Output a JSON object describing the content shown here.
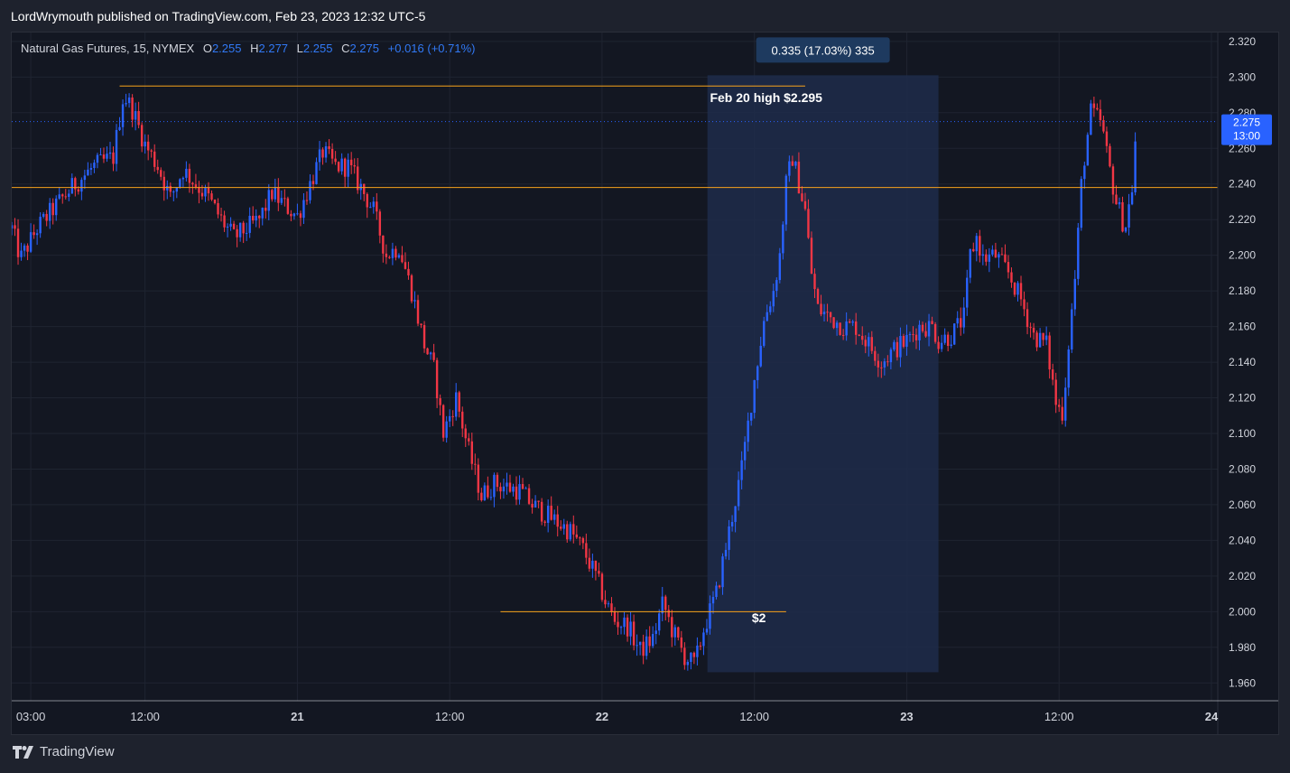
{
  "header": {
    "published_text": "LordWrymouth published on TradingView.com, Feb 23, 2023 12:32 UTC-5"
  },
  "legend": {
    "title": "Natural Gas Futures, 15, NYMEX",
    "open_label": "O",
    "open_value": "2.255",
    "high_label": "H",
    "high_value": "2.277",
    "low_label": "L",
    "low_value": "2.255",
    "close_label": "C",
    "close_value": "2.275",
    "change": "+0.016 (+0.71%)"
  },
  "footer": {
    "brand": "TradingView"
  },
  "colors": {
    "background": "#131722",
    "up": "#2962ff",
    "down": "#f23645",
    "hline": "#f7a21b",
    "range_fill": "#1e2b4a",
    "price_tag": "#2962ff"
  },
  "chart_data": {
    "type": "candlestick",
    "symbol": "Natural Gas Futures",
    "interval": "15",
    "exchange": "NYMEX",
    "y_axis": {
      "ylim": [
        1.95,
        2.325
      ],
      "ticks": [
        "2.320",
        "2.300",
        "2.280",
        "2.260",
        "2.240",
        "2.220",
        "2.200",
        "2.180",
        "2.160",
        "2.140",
        "2.120",
        "2.100",
        "2.080",
        "2.060",
        "2.040",
        "2.020",
        "2.000",
        "1.980",
        "1.960"
      ]
    },
    "x_axis": {
      "ticks": [
        {
          "label": "03:00",
          "t": 3
        },
        {
          "label": "12:00",
          "t": 12
        },
        {
          "label": "21",
          "t": 24
        },
        {
          "label": "12:00",
          "t": 36
        },
        {
          "label": "22",
          "t": 48
        },
        {
          "label": "12:00",
          "t": 60
        },
        {
          "label": "23",
          "t": 72
        },
        {
          "label": "12:00",
          "t": 84
        },
        {
          "label": "24",
          "t": 96
        }
      ],
      "xlim": [
        1.5,
        96.5
      ],
      "unit": "hours since Feb 20 00:00"
    },
    "current_price": {
      "value": 2.275,
      "label": "2.275",
      "countdown": "13:00"
    },
    "horizontal_lines": [
      {
        "value": 2.295,
        "t_start": 10,
        "t_end": 64
      },
      {
        "value": 2.238,
        "t_start": 1.5,
        "t_end": 96.5
      },
      {
        "value": 2.0,
        "t_start": 40,
        "t_end": 62.5
      }
    ],
    "annotations": [
      {
        "text": "Feb 20 high $2.295",
        "t": 56.5,
        "value": 2.286
      },
      {
        "text": "$2",
        "t": 59.8,
        "value": 1.994
      }
    ],
    "price_range": {
      "t_start": 56.3,
      "t_end": 74.5,
      "low": 1.966,
      "high": 2.301,
      "label": "0.335 (17.03%) 335"
    },
    "price_path": [
      [
        1.5,
        2.215
      ],
      [
        2.2,
        2.198
      ],
      [
        3.5,
        2.215
      ],
      [
        5.0,
        2.228
      ],
      [
        6.5,
        2.24
      ],
      [
        8.0,
        2.25
      ],
      [
        9.5,
        2.255
      ],
      [
        10.3,
        2.29
      ],
      [
        11.0,
        2.282
      ],
      [
        12.0,
        2.262
      ],
      [
        13.0,
        2.25
      ],
      [
        14.0,
        2.232
      ],
      [
        15.0,
        2.248
      ],
      [
        16.0,
        2.24
      ],
      [
        17.0,
        2.232
      ],
      [
        18.0,
        2.22
      ],
      [
        19.0,
        2.21
      ],
      [
        20.0,
        2.215
      ],
      [
        21.0,
        2.22
      ],
      [
        22.0,
        2.235
      ],
      [
        23.0,
        2.228
      ],
      [
        24.0,
        2.222
      ],
      [
        25.0,
        2.24
      ],
      [
        26.0,
        2.258
      ],
      [
        27.0,
        2.25
      ],
      [
        28.0,
        2.25
      ],
      [
        29.0,
        2.238
      ],
      [
        30.0,
        2.225
      ],
      [
        31.0,
        2.2
      ],
      [
        32.0,
        2.205
      ],
      [
        33.0,
        2.18
      ],
      [
        34.0,
        2.15
      ],
      [
        34.8,
        2.135
      ],
      [
        35.5,
        2.1
      ],
      [
        36.5,
        2.12
      ],
      [
        37.5,
        2.09
      ],
      [
        38.5,
        2.065
      ],
      [
        39.5,
        2.072
      ],
      [
        40.5,
        2.07
      ],
      [
        41.5,
        2.068
      ],
      [
        42.5,
        2.06
      ],
      [
        43.5,
        2.055
      ],
      [
        44.5,
        2.05
      ],
      [
        45.5,
        2.045
      ],
      [
        46.5,
        2.035
      ],
      [
        47.5,
        2.02
      ],
      [
        48.3,
        2.005
      ],
      [
        49.0,
        1.995
      ],
      [
        50.0,
        1.992
      ],
      [
        51.0,
        1.978
      ],
      [
        52.0,
        1.985
      ],
      [
        52.8,
        2.005
      ],
      [
        53.5,
        1.99
      ],
      [
        54.5,
        1.975
      ],
      [
        55.3,
        1.97
      ],
      [
        56.0,
        1.99
      ],
      [
        57.0,
        2.01
      ],
      [
        58.0,
        2.045
      ],
      [
        59.0,
        2.08
      ],
      [
        60.0,
        2.13
      ],
      [
        60.8,
        2.165
      ],
      [
        61.5,
        2.18
      ],
      [
        62.0,
        2.2
      ],
      [
        62.5,
        2.24
      ],
      [
        63.0,
        2.255
      ],
      [
        63.5,
        2.24
      ],
      [
        64.0,
        2.225
      ],
      [
        64.5,
        2.19
      ],
      [
        65.0,
        2.17
      ],
      [
        66.0,
        2.165
      ],
      [
        67.0,
        2.16
      ],
      [
        68.0,
        2.16
      ],
      [
        69.0,
        2.15
      ],
      [
        70.0,
        2.14
      ],
      [
        71.0,
        2.147
      ],
      [
        72.0,
        2.152
      ],
      [
        73.0,
        2.16
      ],
      [
        74.0,
        2.16
      ],
      [
        74.5,
        2.152
      ],
      [
        75.5,
        2.155
      ],
      [
        76.5,
        2.165
      ],
      [
        77.0,
        2.2
      ],
      [
        77.5,
        2.21
      ],
      [
        78.0,
        2.198
      ],
      [
        79.0,
        2.2
      ],
      [
        80.0,
        2.19
      ],
      [
        81.0,
        2.175
      ],
      [
        82.0,
        2.155
      ],
      [
        83.0,
        2.15
      ],
      [
        83.8,
        2.115
      ],
      [
        84.3,
        2.112
      ],
      [
        84.8,
        2.155
      ],
      [
        85.3,
        2.19
      ],
      [
        85.8,
        2.245
      ],
      [
        86.5,
        2.28
      ],
      [
        87.3,
        2.275
      ],
      [
        87.8,
        2.255
      ],
      [
        88.5,
        2.23
      ],
      [
        89.2,
        2.215
      ],
      [
        89.8,
        2.24
      ],
      [
        90.1,
        2.275
      ]
    ]
  }
}
